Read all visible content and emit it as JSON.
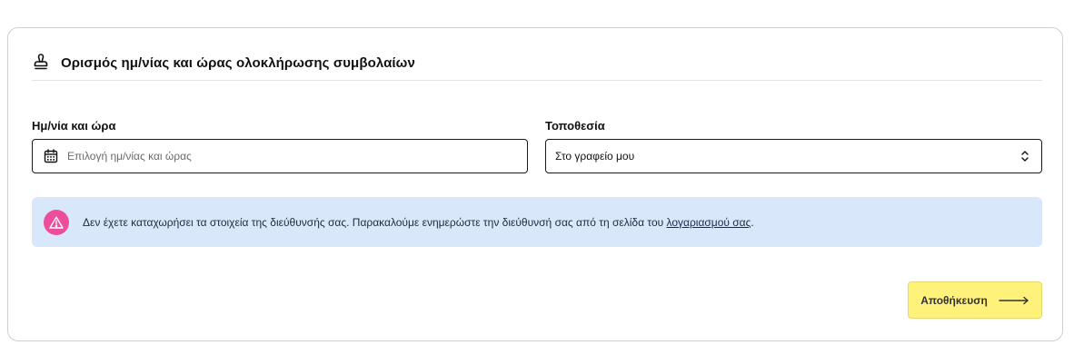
{
  "section": {
    "title": "Ορισμός ημ/νίας και ώρας ολοκλήρωσης συμβολαίων",
    "icon": "stamp-icon"
  },
  "form": {
    "date_label": "Ημ/νία και ώρα",
    "date_placeholder": "Επιλογή ημ/νίας και ώρας",
    "date_value": "",
    "date_icon": "calendar-icon",
    "location_label": "Τοποθεσία",
    "location_value": "Στο γραφείο μου",
    "location_icon": "chevron-up-down-icon"
  },
  "alert": {
    "icon": "warning-icon",
    "text": "Δεν έχετε καταχωρήσει τα στοιχεία της διεύθυνσής σας. Παρακαλούμε ενημερώστε την διεύθυνσή σας από τη σελίδα του ",
    "link_text": "λογαριασμού σας",
    "suffix": ".",
    "background": "#d8e7fa",
    "icon_color": "#ee4d9b"
  },
  "actions": {
    "save_label": "Αποθήκευση",
    "save_icon": "arrow-right-icon",
    "save_color": "#fff27a"
  }
}
